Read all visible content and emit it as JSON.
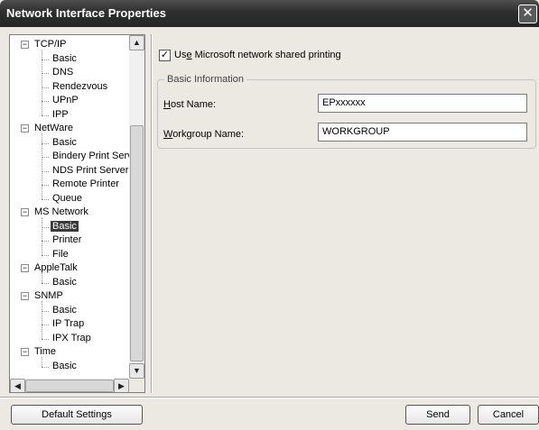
{
  "window": {
    "title": "Network Interface Properties",
    "close_glyph": "✕"
  },
  "tree": {
    "nodes": [
      {
        "label": "TCP/IP",
        "level": 0,
        "expanded": true
      },
      {
        "label": "Basic",
        "level": 1
      },
      {
        "label": "DNS",
        "level": 1
      },
      {
        "label": "Rendezvous",
        "level": 1
      },
      {
        "label": "UPnP",
        "level": 1
      },
      {
        "label": "IPP",
        "level": 1
      },
      {
        "label": "NetWare",
        "level": 0,
        "expanded": true
      },
      {
        "label": "Basic",
        "level": 1
      },
      {
        "label": "Bindery Print Server",
        "level": 1
      },
      {
        "label": "NDS Print Server",
        "level": 1
      },
      {
        "label": "Remote Printer",
        "level": 1
      },
      {
        "label": "Queue",
        "level": 1
      },
      {
        "label": "MS Network",
        "level": 0,
        "expanded": true
      },
      {
        "label": "Basic",
        "level": 1,
        "selected": true
      },
      {
        "label": "Printer",
        "level": 1
      },
      {
        "label": "File",
        "level": 1
      },
      {
        "label": "AppleTalk",
        "level": 0,
        "expanded": true
      },
      {
        "label": "Basic",
        "level": 1
      },
      {
        "label": "SNMP",
        "level": 0,
        "expanded": true
      },
      {
        "label": "Basic",
        "level": 1
      },
      {
        "label": "IP Trap",
        "level": 1
      },
      {
        "label": "IPX Trap",
        "level": 1
      },
      {
        "label": "Time",
        "level": 0,
        "expanded": true
      },
      {
        "label": "Basic",
        "level": 1
      }
    ],
    "collapse_glyph": "−",
    "scroll_up_glyph": "▲",
    "scroll_down_glyph": "▼",
    "scroll_left_glyph": "◀",
    "scroll_right_glyph": "▶"
  },
  "settings": {
    "shared_printing": {
      "checked": true,
      "check_glyph": "✓",
      "label_pre": "Us",
      "label_accel": "e",
      "label_post": " Microsoft network shared printing"
    },
    "basic_info": {
      "title": "Basic Information",
      "host_name": {
        "label_accel": "H",
        "label_rest": "ost Name:",
        "value": "EPxxxxxx"
      },
      "workgroup_name": {
        "label_accel": "W",
        "label_rest": "orkgroup Name:",
        "value": "WORKGROUP"
      }
    }
  },
  "buttons": {
    "default_settings": "Default Settings",
    "send": "Send",
    "cancel": "Cancel"
  }
}
